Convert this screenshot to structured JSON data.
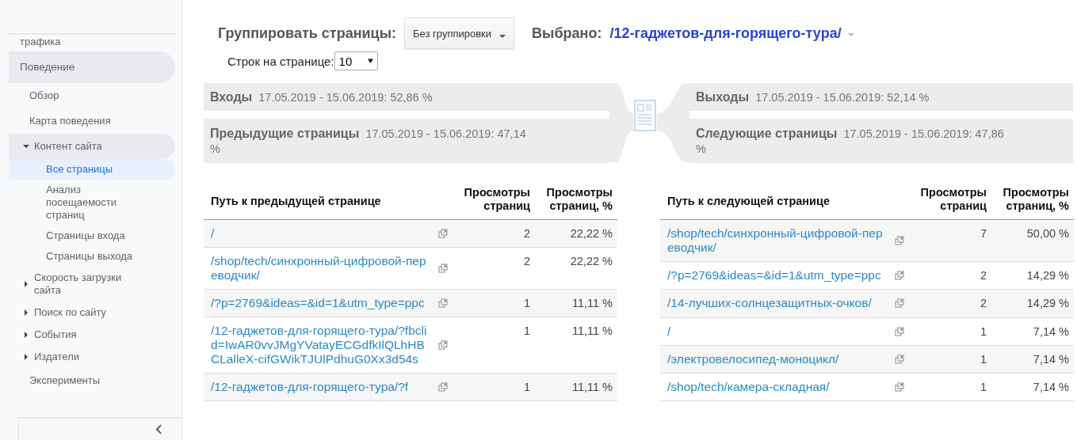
{
  "sidebar": {
    "items": [
      {
        "label": "трафика",
        "kind": "tail",
        "selected": false
      },
      {
        "label": "Поведение",
        "kind": "section",
        "selected": false,
        "expanded": true,
        "children": [
          {
            "label": "Обзор",
            "selected": false
          },
          {
            "label": "Карта поведения",
            "selected": false
          },
          {
            "label": "Контент сайта",
            "kind": "group",
            "selected": false,
            "expanded": true,
            "children": [
              {
                "label": "Все страницы",
                "selected": true
              },
              {
                "label": "Анализ посещаемости страниц",
                "selected": false
              },
              {
                "label": "Страницы входа",
                "selected": false
              },
              {
                "label": "Страницы выхода",
                "selected": false
              }
            ]
          },
          {
            "label": "Скорость загрузки сайта",
            "kind": "group",
            "selected": false,
            "expanded": false
          },
          {
            "label": "Поиск по сайту",
            "kind": "group",
            "selected": false,
            "expanded": false
          },
          {
            "label": "События",
            "kind": "group",
            "selected": false,
            "expanded": false
          },
          {
            "label": "Издатели",
            "kind": "group",
            "selected": false,
            "expanded": false
          },
          {
            "label": "Эксперименты",
            "selected": false
          }
        ]
      }
    ]
  },
  "toolbar": {
    "group_label": "Группировать страницы:",
    "group_value": "Без группировки",
    "selected_label": "Выбрано:",
    "selected_value": "/12-гаджетов-для-горящего-тура/",
    "rows_label": "Строк на странице:",
    "rows_value": "10"
  },
  "flow": {
    "left": [
      {
        "title": "Входы",
        "text": "17.05.2019 - 15.06.2019: 52,86 %"
      },
      {
        "title": "Предыдущие страницы",
        "text": "17.05.2019 - 15.06.2019: 47,14 %"
      }
    ],
    "right": [
      {
        "title": "Выходы",
        "text": "17.05.2019 - 15.06.2019: 52,14 %"
      },
      {
        "title": "Следующие страницы",
        "text": "17.05.2019 - 15.06.2019: 47,86 %"
      }
    ]
  },
  "tables": [
    {
      "columns": [
        "Путь к предыдущей странице",
        "Просмотры страниц",
        "Просмотры страниц, %"
      ],
      "rows": [
        {
          "path": "/",
          "views": "2",
          "share": "22,22 %"
        },
        {
          "path": "/shop/tech/синхронный-цифровой-переводчик/",
          "views": "2",
          "share": "22,22 %"
        },
        {
          "path": "/?p=2769&ideas=&id=1&utm_type=ppc",
          "views": "1",
          "share": "11,11 %"
        },
        {
          "path": "/12-гаджетов-для-горящего-тура/?fbclid=IwAR0vvJMgYVatayECGdfkIlQLhHBCLalleX-cifGWikTJUlPdhuG0Xx3d54s",
          "views": "1",
          "share": "11,11 %"
        },
        {
          "path": "/12-гаджетов-для-горящего-тура/?f",
          "views": "1",
          "share": "11,11 %"
        }
      ]
    },
    {
      "columns": [
        "Путь к следующей странице",
        "Просмотры страниц",
        "Просмотры страниц, %"
      ],
      "rows": [
        {
          "path": "/shop/tech/синхронный-цифровой-переводчик/",
          "views": "7",
          "share": "50,00 %"
        },
        {
          "path": "/?p=2769&ideas=&id=1&utm_type=ppc",
          "views": "2",
          "share": "14,29 %"
        },
        {
          "path": "/14-лучших-солнцезащитных-очков/",
          "views": "2",
          "share": "14,29 %"
        },
        {
          "path": "/",
          "views": "1",
          "share": "7,14 %"
        },
        {
          "path": "/электровелосипед-моноцикл/",
          "views": "1",
          "share": "7,14 %"
        },
        {
          "path": "/shop/tech/камера-складная/",
          "views": "1",
          "share": "7,14 %"
        }
      ]
    }
  ]
}
